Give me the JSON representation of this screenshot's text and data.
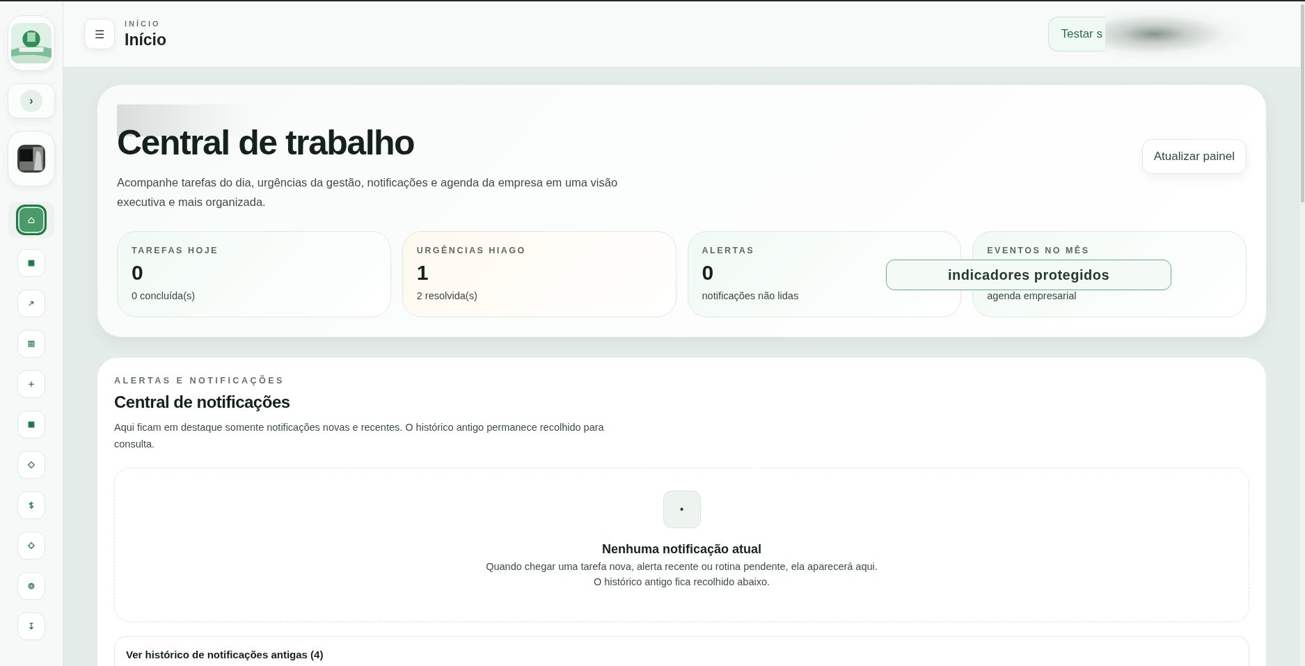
{
  "sidebar": {
    "toggle": "›",
    "nav": [
      {
        "selected": true
      },
      {
        "selected": false
      },
      {
        "selected": false
      },
      {
        "selected": false
      },
      {
        "selected": false
      },
      {
        "selected": false
      },
      {
        "selected": false
      },
      {
        "selected": false
      },
      {
        "selected": false
      },
      {
        "selected": false
      },
      {
        "selected": false
      }
    ]
  },
  "header": {
    "menu": "☰",
    "eyebrow": "INÍCIO",
    "title": "Início",
    "test_button": "Testar s"
  },
  "hero": {
    "title": "Central de trabalho",
    "description": "Acompanhe tarefas do dia, urgências da gestão, notificações e agenda da empresa em uma visão executiva e mais organizada.",
    "refresh_button": "Atualizar painel",
    "stats": [
      {
        "label": "TAREFAS HOJE",
        "value": "0",
        "note": "0 concluída(s)",
        "highlighted": false
      },
      {
        "label": "URGÊNCIAS HIAGO",
        "value": "1",
        "note": "2 resolvida(s)",
        "highlighted": true
      },
      {
        "label": "ALERTAS",
        "value": "0",
        "note": "notificações não lidas",
        "highlighted": false
      },
      {
        "label": "EVENTOS NO MÊS",
        "note": "agenda empresarial",
        "highlighted": false
      }
    ],
    "protected_overlay": "indicadores protegidos"
  },
  "notifications": {
    "eyebrow": "ALERTAS E NOTIFICAÇÕES",
    "title": "Central de notificações",
    "description": "Aqui ficam em destaque somente notificações novas e recentes. O histórico antigo permanece recolhido para consulta.",
    "empty": {
      "icon": "•",
      "title": "Nenhuma notificação atual",
      "lines": [
        "Quando chegar uma tarefa nova, alerta recente ou rotina pendente, ela aparecerá aqui.",
        "O histórico antigo fica recolhido abaixo."
      ]
    },
    "history_toggle": "Ver histórico de notificações antigas (4)"
  }
}
